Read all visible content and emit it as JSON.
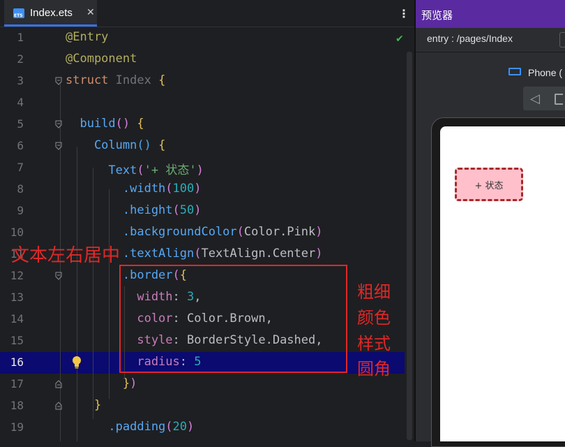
{
  "editor": {
    "tab": {
      "file_icon_label": "ETS",
      "file_name": "Index.ets",
      "close_glyph": "✕"
    },
    "menu_glyph": "⋮",
    "status_check": "✔",
    "lines": [
      {
        "n": "1",
        "segs": [
          [
            "@Entry",
            "dec"
          ]
        ]
      },
      {
        "n": "2",
        "segs": [
          [
            "@Component",
            "dec"
          ]
        ]
      },
      {
        "n": "3",
        "segs": [
          [
            "struct ",
            "kw"
          ],
          [
            "Index ",
            "type"
          ],
          [
            "{",
            "brace1"
          ]
        ]
      },
      {
        "n": "4",
        "segs": []
      },
      {
        "n": "5",
        "segs": [
          [
            "  build",
            "fn"
          ],
          [
            "() ",
            "brace2"
          ],
          [
            "{",
            "brace1"
          ]
        ]
      },
      {
        "n": "6",
        "segs": [
          [
            "    Column",
            "fn"
          ],
          [
            "() ",
            "brace3"
          ],
          [
            "{",
            "brace1"
          ]
        ]
      },
      {
        "n": "7",
        "segs": [
          [
            "      Text",
            "fn"
          ],
          [
            "(",
            "brace2"
          ],
          [
            "'+ 状态'",
            "str"
          ],
          [
            ")",
            "brace2"
          ]
        ]
      },
      {
        "n": "8",
        "segs": [
          [
            "        .width",
            "fn"
          ],
          [
            "(",
            "brace2"
          ],
          [
            "100",
            "num"
          ],
          [
            ")",
            "brace2"
          ]
        ]
      },
      {
        "n": "9",
        "segs": [
          [
            "        .height",
            "fn"
          ],
          [
            "(",
            "brace2"
          ],
          [
            "50",
            "num"
          ],
          [
            ")",
            "brace2"
          ]
        ]
      },
      {
        "n": "10",
        "segs": [
          [
            "        .backgroundColor",
            "fn"
          ],
          [
            "(",
            "brace2"
          ],
          [
            "Color.Pink",
            "cls"
          ],
          [
            ")",
            "brace2"
          ]
        ]
      },
      {
        "n": "11",
        "segs": [
          [
            "        .textAlign",
            "fn"
          ],
          [
            "(",
            "brace2"
          ],
          [
            "TextAlign.Center",
            "cls"
          ],
          [
            ")",
            "brace2"
          ]
        ]
      },
      {
        "n": "12",
        "segs": [
          [
            "        .border",
            "fn"
          ],
          [
            "(",
            "brace2"
          ],
          [
            "{",
            "brace1"
          ]
        ]
      },
      {
        "n": "13",
        "segs": [
          [
            "          width",
            "prop"
          ],
          [
            ": ",
            "plain"
          ],
          [
            "3",
            "num"
          ],
          [
            ",",
            "plain"
          ]
        ]
      },
      {
        "n": "14",
        "segs": [
          [
            "          color",
            "prop"
          ],
          [
            ": ",
            "plain"
          ],
          [
            "Color.Brown",
            "cls"
          ],
          [
            ",",
            "plain"
          ]
        ]
      },
      {
        "n": "15",
        "segs": [
          [
            "          style",
            "prop"
          ],
          [
            ": ",
            "plain"
          ],
          [
            "BorderStyle.Dashed",
            "cls"
          ],
          [
            ",",
            "plain"
          ]
        ]
      },
      {
        "n": "16",
        "segs": [
          [
            "          radius",
            "prop"
          ],
          [
            ": ",
            "plain"
          ],
          [
            "5",
            "num"
          ]
        ],
        "active": true
      },
      {
        "n": "17",
        "segs": [
          [
            "        }",
            "brace1"
          ],
          [
            ")",
            "brace2"
          ]
        ]
      },
      {
        "n": "18",
        "segs": [
          [
            "    }",
            "brace1"
          ]
        ]
      },
      {
        "n": "19",
        "segs": [
          [
            "      .padding",
            "fn"
          ],
          [
            "(",
            "brace2"
          ],
          [
            "20",
            "num"
          ],
          [
            ")",
            "brace2"
          ]
        ]
      }
    ]
  },
  "annotations": {
    "left": "文本左右居中",
    "right": [
      "粗细",
      "颜色",
      "样式",
      "圆角"
    ]
  },
  "previewer": {
    "title": "预览器",
    "route": "entry : /pages/Index",
    "device": "Phone (",
    "back_glyph": "◁",
    "rendered_text": "+ 状态"
  },
  "colors": {
    "accent": "#3574f0",
    "annotation_red": "#e02828",
    "previewer_header": "#5a2aa0",
    "pink": "#ffc0cb",
    "brown": "#a52a2a"
  }
}
